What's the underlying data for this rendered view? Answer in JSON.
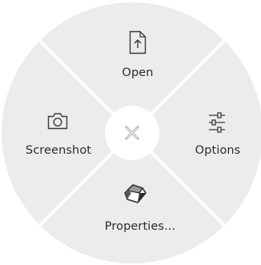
{
  "menu": {
    "items": [
      {
        "id": "open",
        "label": "Open",
        "icon": "file-upload-icon"
      },
      {
        "id": "options",
        "label": "Options",
        "icon": "sliders-icon"
      },
      {
        "id": "properties",
        "label": "Properties...",
        "icon": "cube-icon"
      },
      {
        "id": "screenshot",
        "label": "Screenshot",
        "icon": "camera-icon"
      }
    ],
    "close_icon": "close-icon"
  },
  "colors": {
    "segment": "#ececec",
    "divider": "#ffffff",
    "center": "#ffffff",
    "text": "#2b2b2b",
    "icon": "#3a3a3a",
    "close": "#a8a8a8"
  }
}
